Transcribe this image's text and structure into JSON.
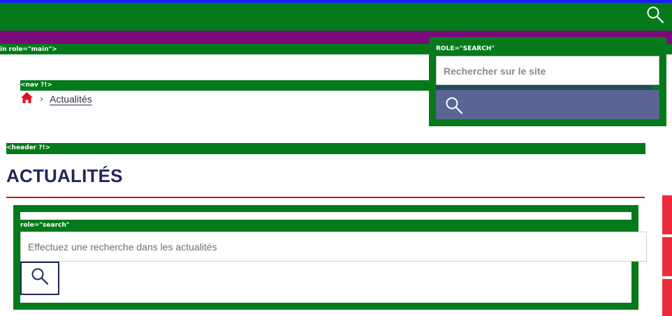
{
  "top_bar": {
    "search_icon": "search-icon"
  },
  "main": {
    "role_label": "in role=\"main\">"
  },
  "site_search": {
    "role_label": "ROLE=\"SEARCH\"",
    "placeholder": "Rechercher sur le site",
    "button_icon": "search-icon"
  },
  "nav": {
    "label": "<nav ?!>",
    "home_icon": "home-icon",
    "separator": "›",
    "current": "Actualités"
  },
  "header": {
    "label": "<header ?!>",
    "title": "ACTUALITÉS"
  },
  "news_search": {
    "role_label": "role=\"search\"",
    "placeholder": "Effectuez une recherche dans les actualités",
    "button_icon": "search-icon"
  },
  "colors": {
    "debug_green": "#047a1b",
    "debug_blue": "#1a1aff",
    "debug_purple": "#7a0a7c",
    "title_navy": "#22275a",
    "accent_red": "#d3121d",
    "side_tab_red": "#ef2a3a",
    "search_button_slate": "#5a6594"
  }
}
